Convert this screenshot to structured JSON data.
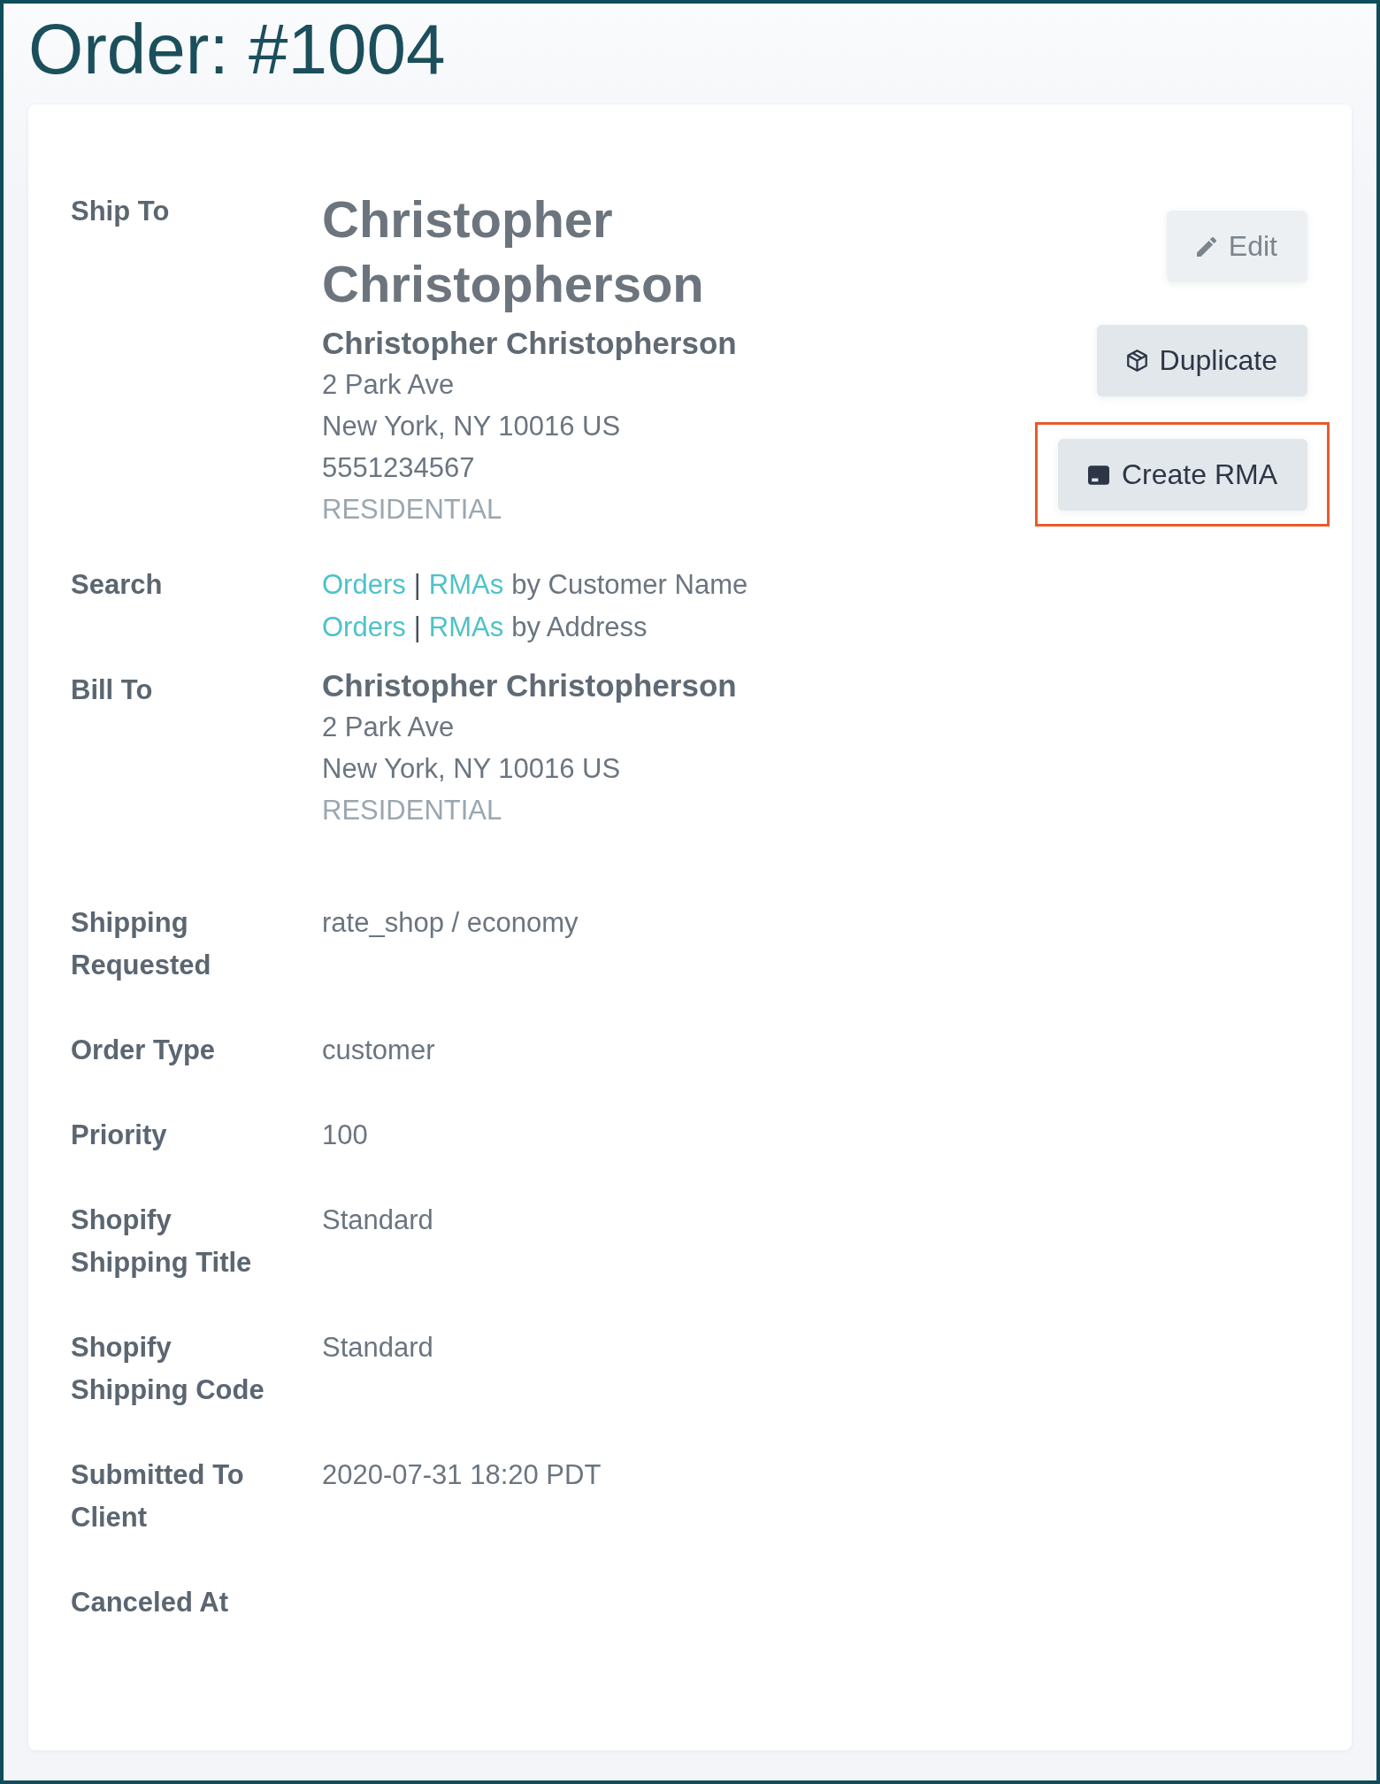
{
  "page": {
    "title": "Order: #1004"
  },
  "details": [
    {
      "kind": "address",
      "label": "Ship To",
      "heading": "Christopher Christopherson",
      "name": "Christopher Christopherson",
      "lines": [
        "2 Park Ave",
        "New York, NY 10016 US",
        "5551234567"
      ],
      "address_type": "RESIDENTIAL"
    },
    {
      "kind": "search",
      "label": "Search",
      "lines": [
        {
          "links": [
            "Orders",
            "RMAs"
          ],
          "separator": "|",
          "text": "by Customer Name"
        },
        {
          "links": [
            "Orders",
            "RMAs"
          ],
          "separator": "|",
          "text": "by Address"
        }
      ]
    },
    {
      "kind": "address",
      "label": "Bill To",
      "name": "Christopher Christopherson",
      "lines": [
        "2 Park Ave",
        "New York, NY 10016 US"
      ],
      "address_type": "RESIDENTIAL"
    },
    {
      "kind": "text",
      "label": "Shipping Requested",
      "value": "rate_shop / economy"
    },
    {
      "kind": "text",
      "label": "Order Type",
      "value": "customer"
    },
    {
      "kind": "text",
      "label": "Priority",
      "value": "100"
    },
    {
      "kind": "text",
      "label": "Shopify Shipping Title",
      "value": "Standard"
    },
    {
      "kind": "text",
      "label": "Shopify Shipping Code",
      "value": "Standard"
    },
    {
      "kind": "text",
      "label": "Submitted To Client",
      "value": "2020-07-31 18:20 PDT"
    },
    {
      "kind": "text",
      "label": "Canceled At"
    }
  ],
  "actions": [
    {
      "kind": "edit",
      "label": "Edit",
      "disabled": true,
      "highlighted": false
    },
    {
      "kind": "duplicate",
      "label": "Duplicate",
      "disabled": false,
      "highlighted": false
    },
    {
      "kind": "rma",
      "label": "Create RMA",
      "disabled": false,
      "highlighted": true
    }
  ]
}
